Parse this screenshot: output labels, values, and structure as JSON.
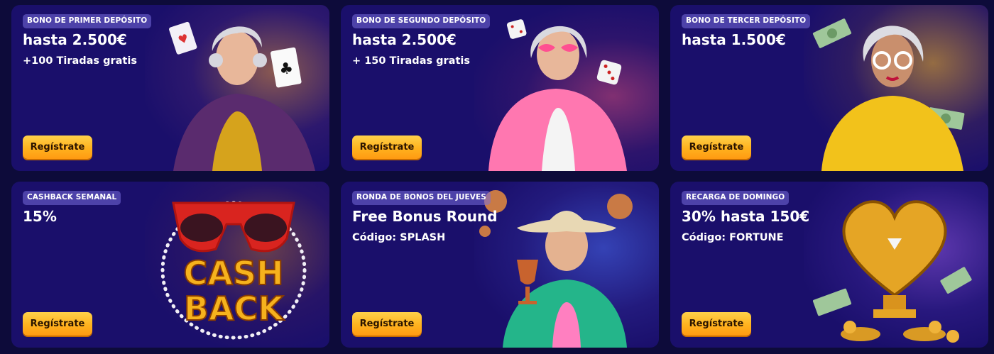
{
  "cards": [
    {
      "badge": "BONO DE PRIMER DEPÓSITO",
      "title": "hasta 2.500€",
      "sub": "+100 Tiradas gratis",
      "button": "Regístrate",
      "illustration": "woman-with-playing-cards"
    },
    {
      "badge": "BONO DE SEGUNDO DEPÓSITO",
      "title": "hasta 2.500€",
      "sub": "+ 150 Tiradas gratis",
      "button": "Regístrate",
      "illustration": "woman-with-dice"
    },
    {
      "badge": "BONO DE TERCER DEPÓSITO",
      "title": "hasta 1.500€",
      "sub": "",
      "button": "Regístrate",
      "illustration": "woman-with-money"
    },
    {
      "badge": "CASHBACK SEMANAL",
      "title": "15%",
      "sub": "",
      "button": "Regístrate",
      "illustration": "cashback-sunglasses",
      "art_text_1": "CASH",
      "art_text_2": "BACK"
    },
    {
      "badge": "RONDA DE BONOS DEL JUEVES",
      "title": "Free Bonus Round",
      "sub": "Código: SPLASH",
      "button": "Regístrate",
      "illustration": "woman-with-goblet"
    },
    {
      "badge": "RECARGA DE DOMINGO",
      "title": "30% hasta 150€",
      "sub": "Código: FORTUNE",
      "button": "Regístrate",
      "illustration": "golden-heart-trophy"
    }
  ],
  "colors": {
    "page_bg": "#0d0b3a",
    "card_bg": "#1a0f6b",
    "button_top": "#ffd14a",
    "button_bottom": "#ff9a12",
    "badge_bg": "#6e64d2"
  }
}
